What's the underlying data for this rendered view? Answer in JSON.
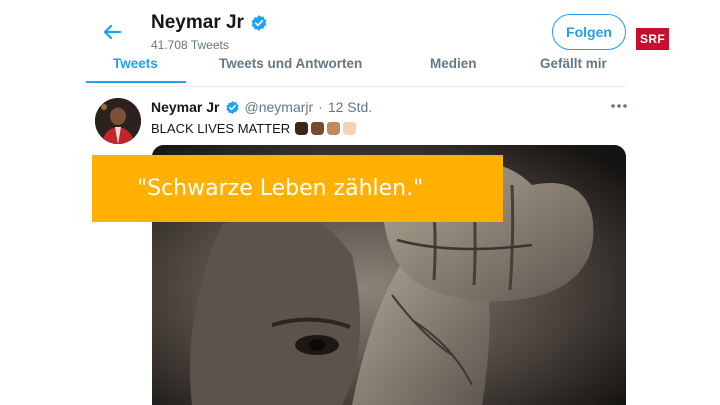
{
  "header": {
    "profile_name": "Neymar Jr",
    "tweet_count": "41.708 Tweets",
    "follow_label": "Folgen"
  },
  "broadcaster_logo": "SRF",
  "tabs": [
    {
      "label": "Tweets",
      "active": true
    },
    {
      "label": "Tweets und Antworten",
      "active": false
    },
    {
      "label": "Medien",
      "active": false
    },
    {
      "label": "Gefällt mir",
      "active": false
    }
  ],
  "tweet": {
    "author_name": "Neymar Jr",
    "handle": "@neymarjr",
    "separator": "·",
    "time": "12 Std.",
    "text": "BLACK LIVES MATTER",
    "emoji_skin_tones": [
      "#3d2418",
      "#7a4a2e",
      "#c08a5c",
      "#f2d3b3"
    ]
  },
  "caption": {
    "text": "\"Schwarze Leben zählen.\""
  },
  "colors": {
    "accent": "#1da1f2",
    "caption_bg": "#ffb000",
    "logo_bg": "#c8102e",
    "muted": "#657786"
  }
}
